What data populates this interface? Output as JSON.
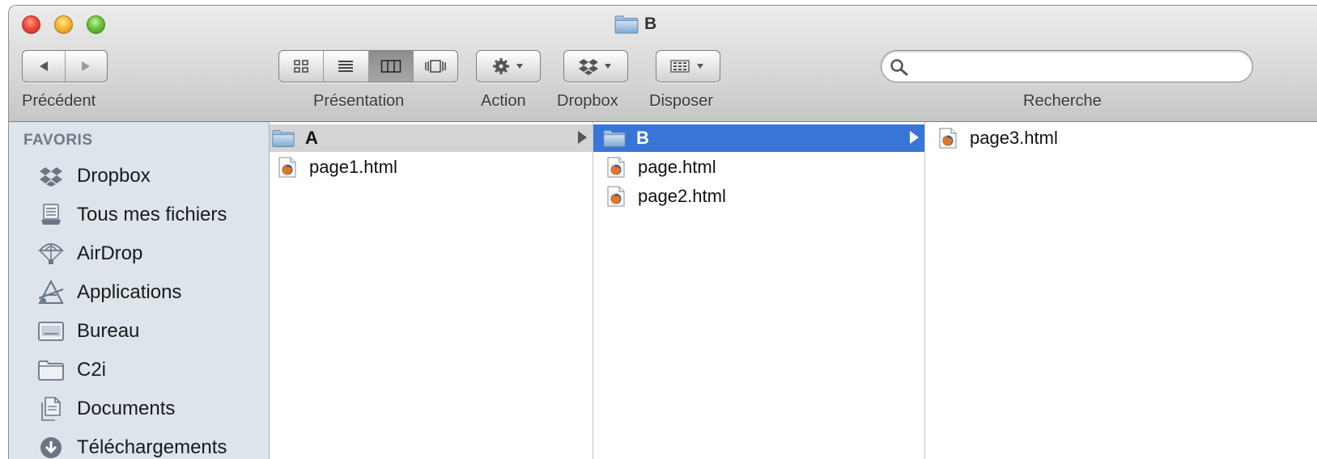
{
  "window": {
    "title": "B",
    "title_icon": "folder-icon"
  },
  "toolbar": {
    "back_label": "Précédent",
    "view_label": "Présentation",
    "action_label": "Action",
    "dropbox_label": "Dropbox",
    "arrange_label": "Disposer",
    "search_label": "Recherche",
    "search_value": "",
    "view_modes": [
      "icon-view",
      "list-view",
      "column-view",
      "coverflow-view"
    ],
    "active_view": "column-view"
  },
  "sidebar": {
    "header": "FAVORIS",
    "items": [
      {
        "label": "Dropbox",
        "icon": "dropbox-icon"
      },
      {
        "label": "Tous mes fichiers",
        "icon": "all-files-icon"
      },
      {
        "label": "AirDrop",
        "icon": "airdrop-icon"
      },
      {
        "label": "Applications",
        "icon": "applications-icon"
      },
      {
        "label": "Bureau",
        "icon": "desktop-icon"
      },
      {
        "label": "C2i",
        "icon": "folder-icon"
      },
      {
        "label": "Documents",
        "icon": "documents-icon"
      },
      {
        "label": "Téléchargements",
        "icon": "downloads-icon"
      }
    ]
  },
  "columns": [
    {
      "items": [
        {
          "label": "A",
          "kind": "folder",
          "state": "path"
        },
        {
          "label": "page1.html",
          "kind": "html"
        }
      ]
    },
    {
      "items": [
        {
          "label": "B",
          "kind": "folder",
          "state": "selected"
        },
        {
          "label": "page.html",
          "kind": "html"
        },
        {
          "label": "page2.html",
          "kind": "html"
        }
      ]
    },
    {
      "items": [
        {
          "label": "page3.html",
          "kind": "html"
        }
      ]
    }
  ],
  "colors": {
    "selection": "#3875d7",
    "path_selection": "#d4d4d4",
    "sidebar_bg": "#dde4ec"
  }
}
